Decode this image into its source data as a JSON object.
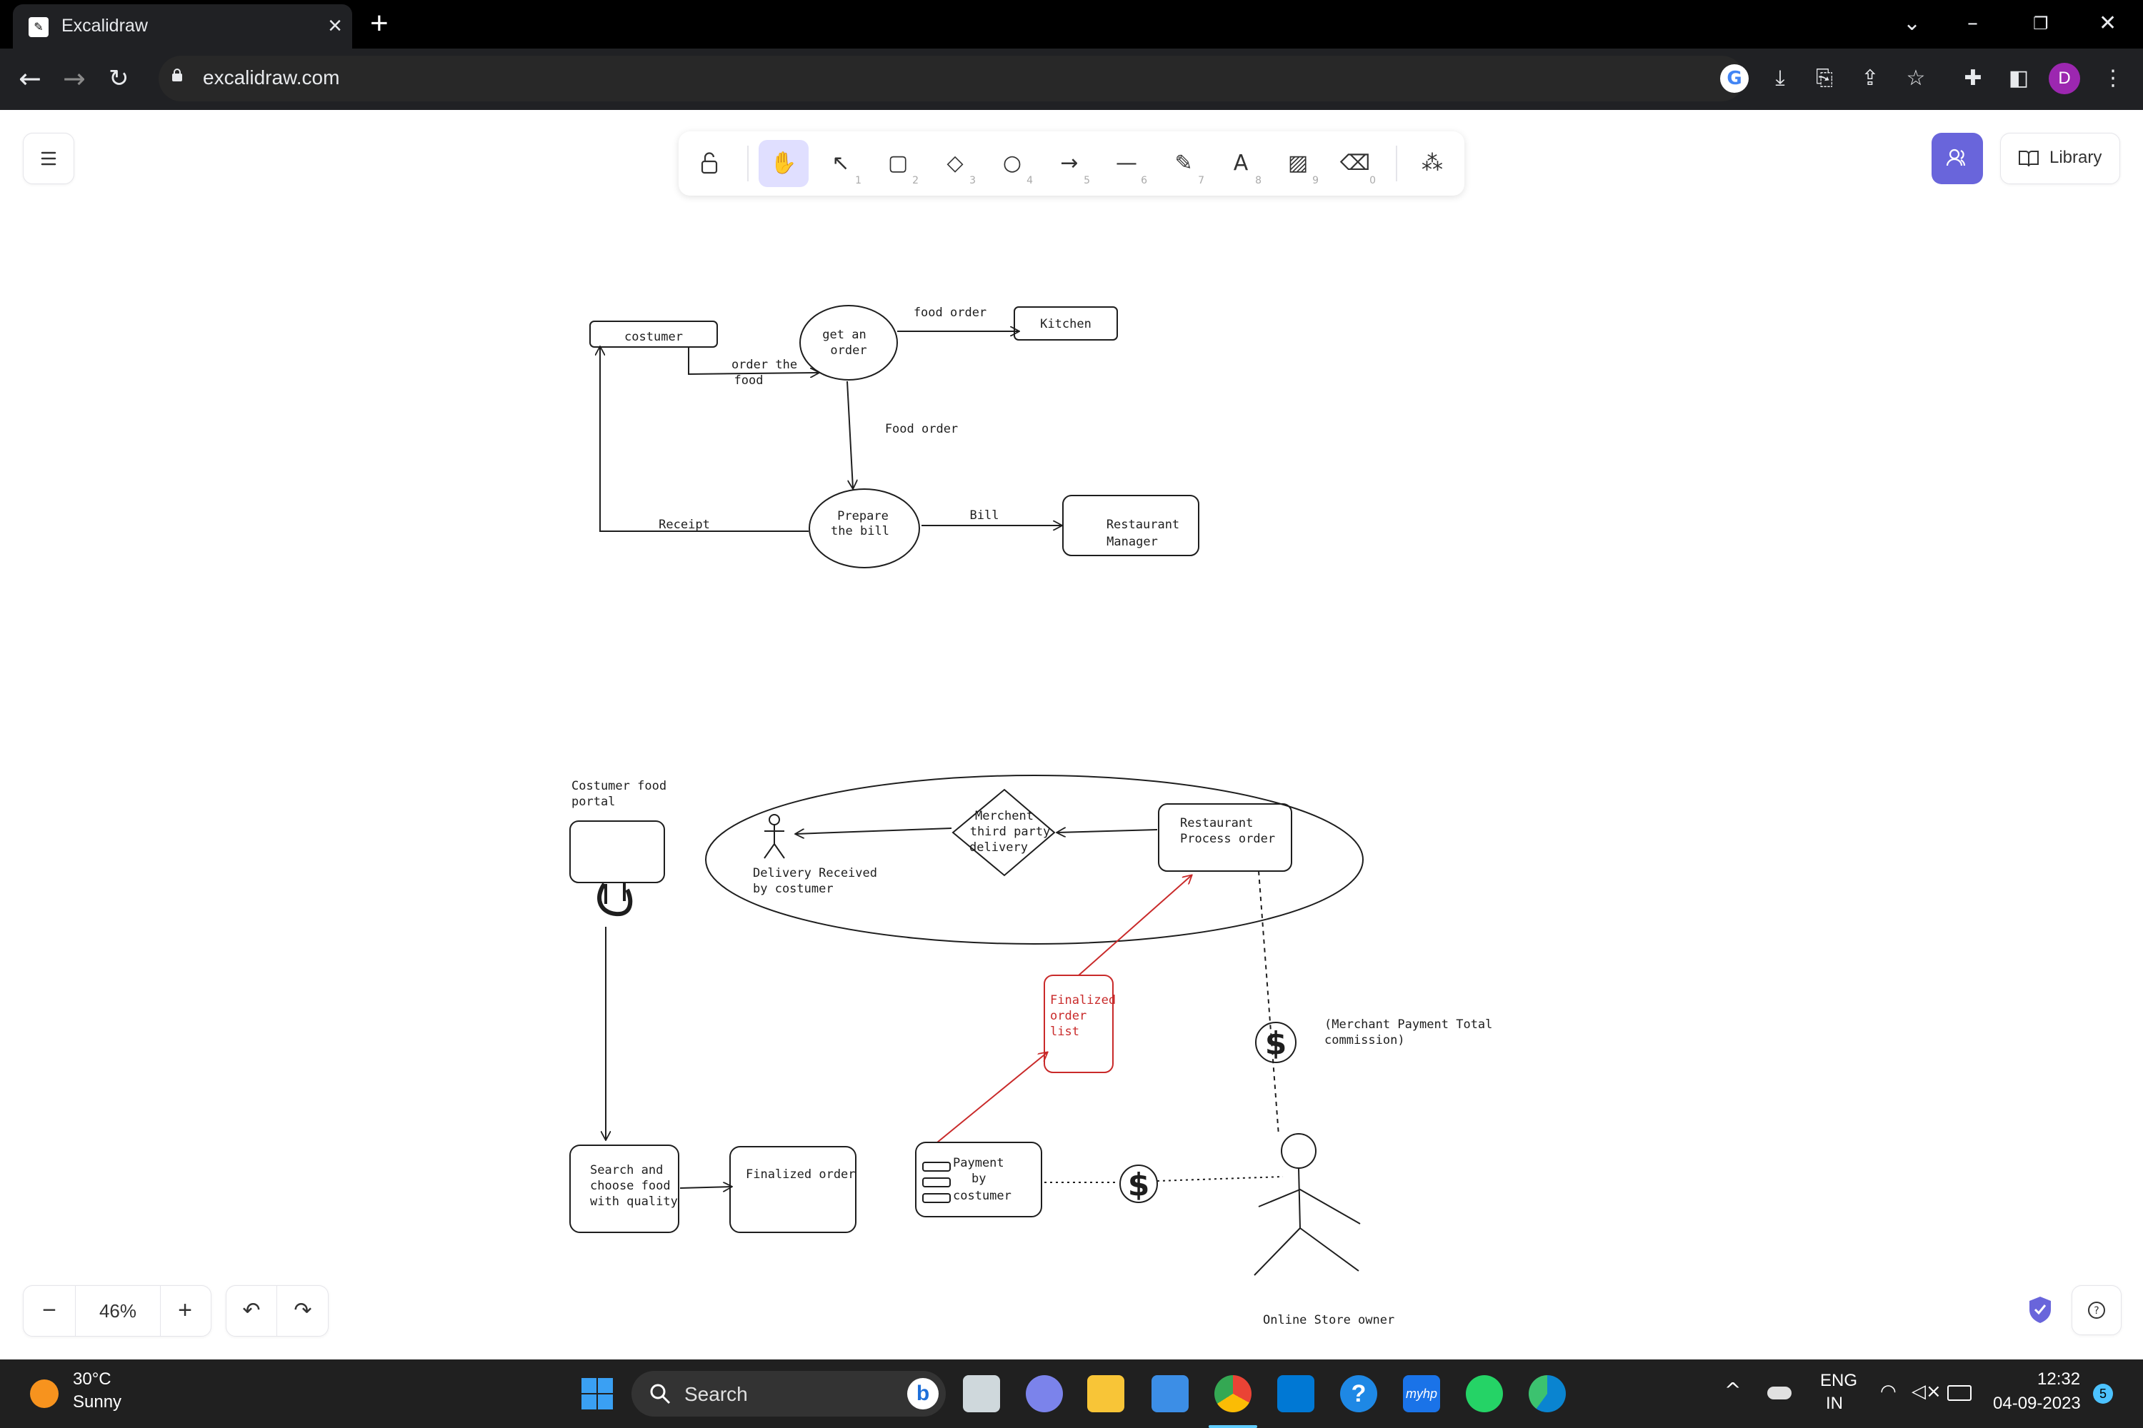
{
  "browser": {
    "tab_title": "Excalidraw",
    "url": "excalidraw.com",
    "profile_initial": "D"
  },
  "excalidraw": {
    "tools": [
      {
        "name": "lock",
        "key": ""
      },
      {
        "name": "hand",
        "key": ""
      },
      {
        "name": "selection",
        "key": "1"
      },
      {
        "name": "rectangle",
        "key": "2"
      },
      {
        "name": "diamond",
        "key": "3"
      },
      {
        "name": "ellipse",
        "key": "4"
      },
      {
        "name": "arrow",
        "key": "5"
      },
      {
        "name": "line",
        "key": "6"
      },
      {
        "name": "draw",
        "key": "7"
      },
      {
        "name": "text",
        "key": "8"
      },
      {
        "name": "image",
        "key": "9"
      },
      {
        "name": "eraser",
        "key": "0"
      },
      {
        "name": "more-shapes",
        "key": ""
      }
    ],
    "library_label": "Library",
    "zoom": "46%"
  },
  "diagram1": {
    "customer": "costumer",
    "get_order_1": "get an",
    "get_order_2": "order",
    "kitchen": "Kitchen",
    "food_order_top": "food order",
    "order_food_1": "order the",
    "order_food_2": "food",
    "food_order_mid": "Food order",
    "prepare_1": "Prepare",
    "prepare_2": "the bill",
    "bill": "Bill",
    "receipt": "Receipt",
    "manager_1": "Restaurant",
    "manager_2": "Manager"
  },
  "diagram2": {
    "portal_1": "Costumer food",
    "portal_2": "portal",
    "delivery_1": "Delivery Received",
    "delivery_2": "by costumer",
    "merchant_1": "Merchent",
    "merchant_2": "third party",
    "merchant_3": "delivery",
    "restaurant_1": "Restaurant",
    "restaurant_2": "Process order",
    "finalized_list_1": "Finalized",
    "finalized_list_2": "order",
    "finalized_list_3": "list",
    "commission_1": "(Merchant Payment Total",
    "commission_2": "commission)",
    "search_1": "Search and",
    "search_2": "choose food",
    "search_3": "with quality",
    "finalized_order": "Finalized order",
    "payment_1": "Payment",
    "payment_2": "by",
    "payment_3": "costumer",
    "owner": "Online  Store  owner",
    "dollar": "$"
  },
  "taskbar": {
    "temperature": "30°C",
    "weather": "Sunny",
    "search_label": "Search",
    "lang_1": "ENG",
    "lang_2": "IN",
    "time": "12:32",
    "date": "04-09-2023",
    "notifications": "5"
  },
  "colors": {
    "accent": "#6965db",
    "active_tool_bg": "#e0dfff",
    "red_stroke": "#c92a2a",
    "ink": "#1e1e1e"
  }
}
